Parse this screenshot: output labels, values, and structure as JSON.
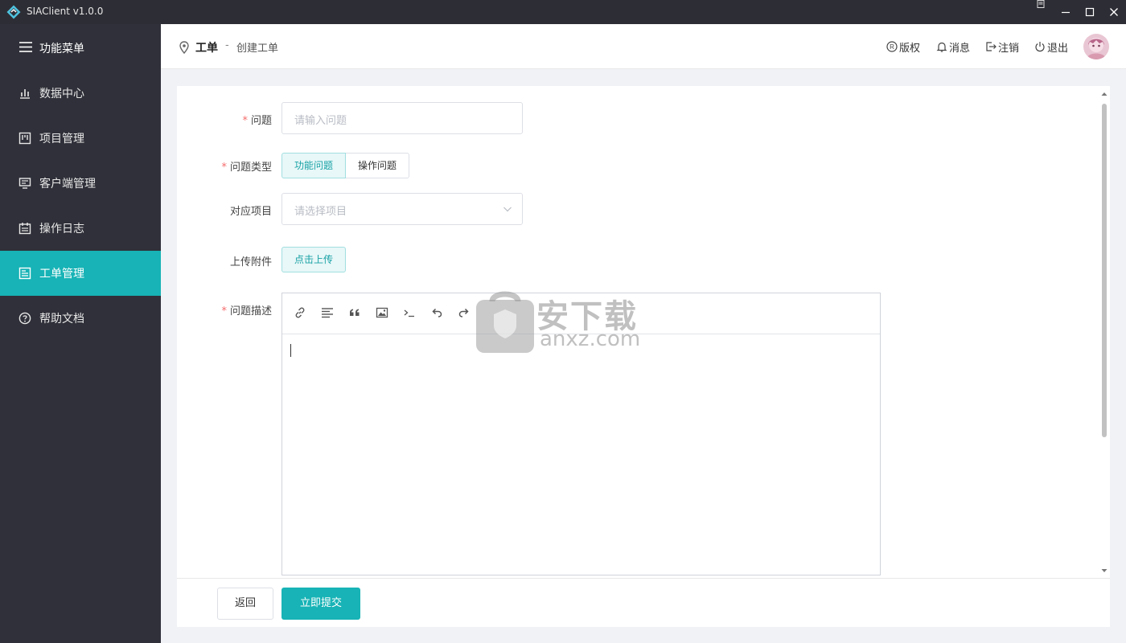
{
  "window": {
    "title": "SIAClient v1.0.0"
  },
  "sidebar": {
    "menu_title": "功能菜单",
    "items": [
      {
        "label": "数据中心",
        "icon": "bar-chart-icon"
      },
      {
        "label": "项目管理",
        "icon": "kanban-icon"
      },
      {
        "label": "客户端管理",
        "icon": "monitor-icon"
      },
      {
        "label": "操作日志",
        "icon": "calendar-icon"
      },
      {
        "label": "工单管理",
        "icon": "ticket-icon",
        "active": true
      },
      {
        "label": "帮助文档",
        "icon": "question-circle-icon"
      }
    ]
  },
  "header": {
    "breadcrumb_main": "工单",
    "breadcrumb_sep": "-",
    "breadcrumb_sub": "创建工单",
    "links": {
      "copyright": "版权",
      "messages": "消息",
      "logout": "注销",
      "exit": "退出"
    }
  },
  "form": {
    "question": {
      "label": "问题",
      "placeholder": "请输入问题",
      "required": true
    },
    "type": {
      "label": "问题类型",
      "required": true,
      "options": [
        "功能问题",
        "操作问题"
      ],
      "selected": "功能问题"
    },
    "project": {
      "label": "对应项目",
      "placeholder": "请选择项目"
    },
    "attachment": {
      "label": "上传附件",
      "button": "点击上传"
    },
    "description": {
      "label": "问题描述",
      "required": true,
      "value": ""
    }
  },
  "editor_toolbar": [
    "link-icon",
    "align-icon",
    "quote-icon",
    "image-icon",
    "code-icon",
    "undo-icon",
    "redo-icon"
  ],
  "actions": {
    "back": "返回",
    "submit": "立即提交"
  },
  "watermark": {
    "big": "安下载",
    "small": "anxz.com"
  },
  "colors": {
    "accent": "#17b3b6",
    "sidebar_bg": "#2f3039",
    "titlebar_bg": "#2d2d35",
    "required": "#f56c6c"
  }
}
